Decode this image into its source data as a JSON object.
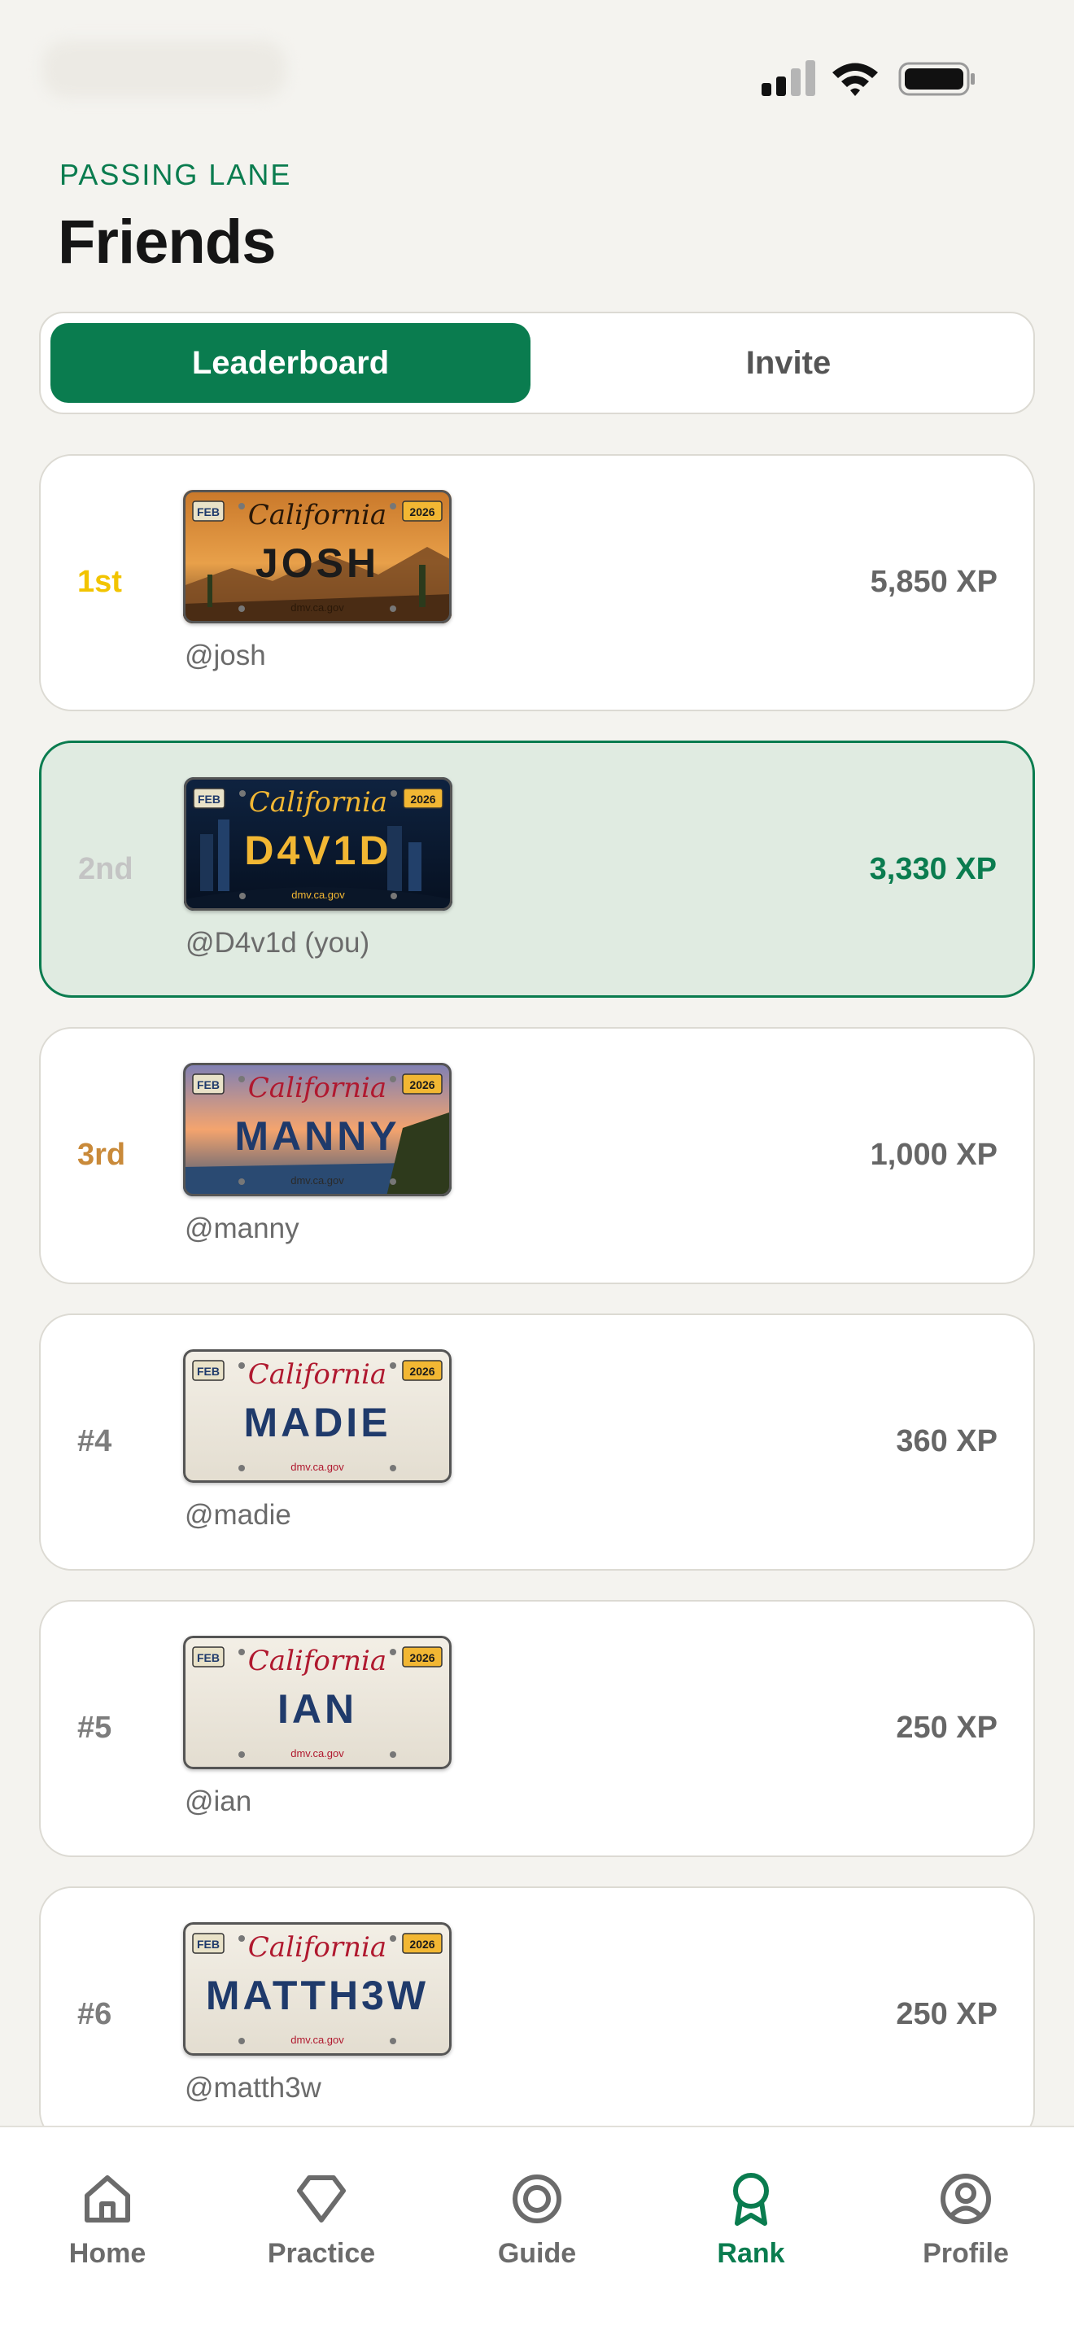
{
  "header": {
    "eyebrow": "PASSING LANE",
    "title": "Friends"
  },
  "tabs": {
    "leaderboard": "Leaderboard",
    "invite": "Invite",
    "active": "leaderboard"
  },
  "plate": {
    "state": "California",
    "month": "FEB",
    "year": "2026",
    "site": "dmv.ca.gov"
  },
  "leaderboard": [
    {
      "rank": "1st",
      "plate": "JOSH",
      "handle": "@josh",
      "xp": "5,850 XP",
      "theme": "desert"
    },
    {
      "rank": "2nd",
      "plate": "D4V1D",
      "handle": "@D4v1d (you)",
      "xp": "3,330 XP",
      "theme": "night"
    },
    {
      "rank": "3rd",
      "plate": "MANNY",
      "handle": "@manny",
      "xp": "1,000 XP",
      "theme": "sunset"
    },
    {
      "rank": "#4",
      "plate": "MADIE",
      "handle": "@madie",
      "xp": "360 XP",
      "theme": "classic"
    },
    {
      "rank": "#5",
      "plate": "IAN",
      "handle": "@ian",
      "xp": "250 XP",
      "theme": "classic"
    },
    {
      "rank": "#6",
      "plate": "MATTH3W",
      "handle": "@matth3w",
      "xp": "250 XP",
      "theme": "classic"
    }
  ],
  "nav": {
    "home": "Home",
    "practice": "Practice",
    "guide": "Guide",
    "rank": "Rank",
    "profile": "Profile",
    "active": "rank"
  },
  "colors": {
    "brand": "#0a7c4f",
    "gold": "#f2c400",
    "silver": "#c4c4c4",
    "bronze": "#c98a3a",
    "plate_text_blue": "#1f3a6b",
    "plate_script_red": "#b0192f"
  },
  "icons": {
    "status": [
      "cellular-signal-icon",
      "wifi-icon",
      "battery-icon"
    ],
    "nav": [
      "house-icon",
      "diamond-icon",
      "target-icon",
      "award-ribbon-icon",
      "user-circle-icon"
    ]
  }
}
